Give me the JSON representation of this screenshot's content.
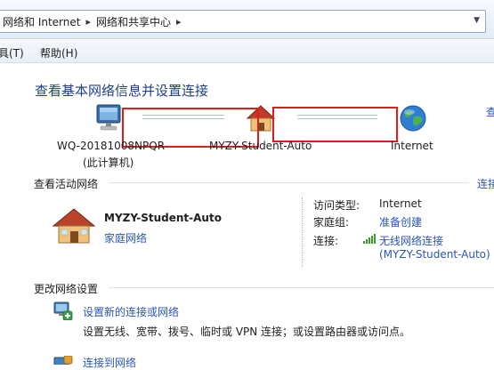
{
  "breadcrumb": {
    "items": [
      "网络和 Internet",
      "网络和共享中心"
    ]
  },
  "menu": {
    "items": [
      "具(T)",
      "帮助(H)"
    ]
  },
  "main": {
    "title": "查看基本网络信息并设置连接",
    "see_full_map_link": "查",
    "network_map": {
      "computer_name": "WQ-20181008NPQR",
      "computer_sub": "(此计算机)",
      "network_name": "MYZY-Student-Auto",
      "internet_label": "Internet"
    },
    "active_section": {
      "heading": "查看活动网络",
      "right_link": "连接",
      "network": {
        "name": "MYZY-Student-Auto",
        "type_link": "家庭网络"
      },
      "details": [
        {
          "key": "访问类型:",
          "value": "Internet"
        },
        {
          "key": "家庭组:",
          "value": "准备创建"
        },
        {
          "key": "连接:",
          "value": "无线网络连接",
          "value2": "(MYZY-Student-Auto)"
        }
      ]
    },
    "change_section": {
      "heading": "更改网络设置",
      "tasks": [
        {
          "title": "设置新的连接或网络",
          "desc": "设置无线、宽带、拨号、临时或 VPN 连接；或设置路由器或访问点。"
        },
        {
          "title": "连接到网络",
          "desc": ""
        }
      ]
    }
  },
  "colors": {
    "link": "#2a55b9",
    "title": "#1e3f8f",
    "highlight_box": "#e51a1a"
  }
}
